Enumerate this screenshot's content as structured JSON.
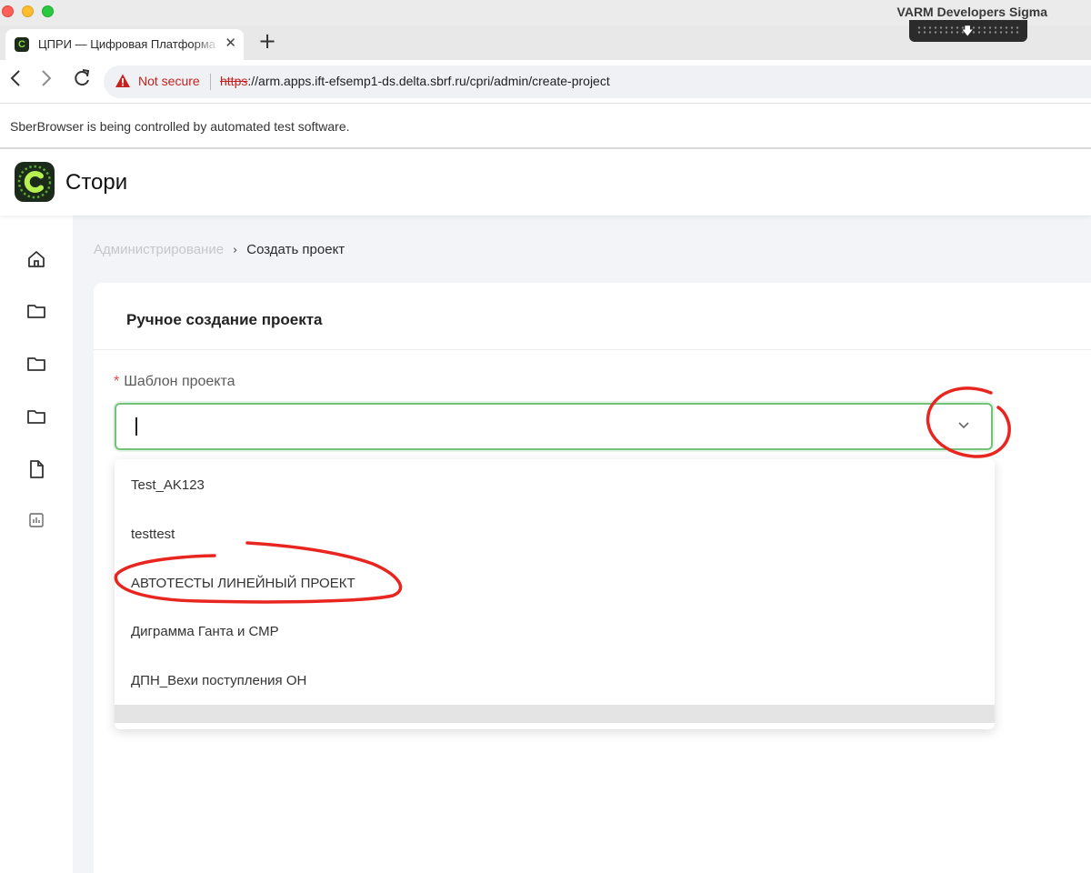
{
  "os": {
    "app_title": "VARM Developers Sigma"
  },
  "browser": {
    "tab": {
      "title": "ЦПРИ — Цифровая Платформа",
      "favicon_letter": "C",
      "close_glyph": "✕"
    },
    "new_tab_glyph": "+",
    "nav": {
      "back": "‹",
      "forward": "›",
      "reload": "↻"
    },
    "security_label": "Not secure",
    "url_scheme": "https",
    "url_rest": "://arm.apps.ift-efsemp1-ds.delta.sbrf.ru/cpri/admin/create-project",
    "infobar_text": "SberBrowser is being controlled by automated test software."
  },
  "app": {
    "name": "Стори",
    "brand_color": "#8ad43e"
  },
  "sidebar": {
    "items": [
      {
        "icon": "home-icon"
      },
      {
        "icon": "folder-icon"
      },
      {
        "icon": "folder-icon"
      },
      {
        "icon": "folder-icon"
      },
      {
        "icon": "document-icon"
      },
      {
        "icon": "chart-icon"
      }
    ]
  },
  "breadcrumb": {
    "parent": "Администрирование",
    "separator": "›",
    "current": "Создать проект"
  },
  "form": {
    "title": "Ручное создание проекта",
    "field_label": "Шаблон проекта",
    "required_mark": "*",
    "value": "",
    "options": [
      "Test_AK123",
      "testtest",
      "АВТОТЕСТЫ ЛИНЕЙНЫЙ ПРОЕКТ",
      "Диграмма Ганта и СМР",
      "ДПН_Вехи поступления ОН"
    ]
  },
  "colors": {
    "focus_border": "#73c27a",
    "annotation": "#e8261f",
    "required": "#e5484d"
  }
}
